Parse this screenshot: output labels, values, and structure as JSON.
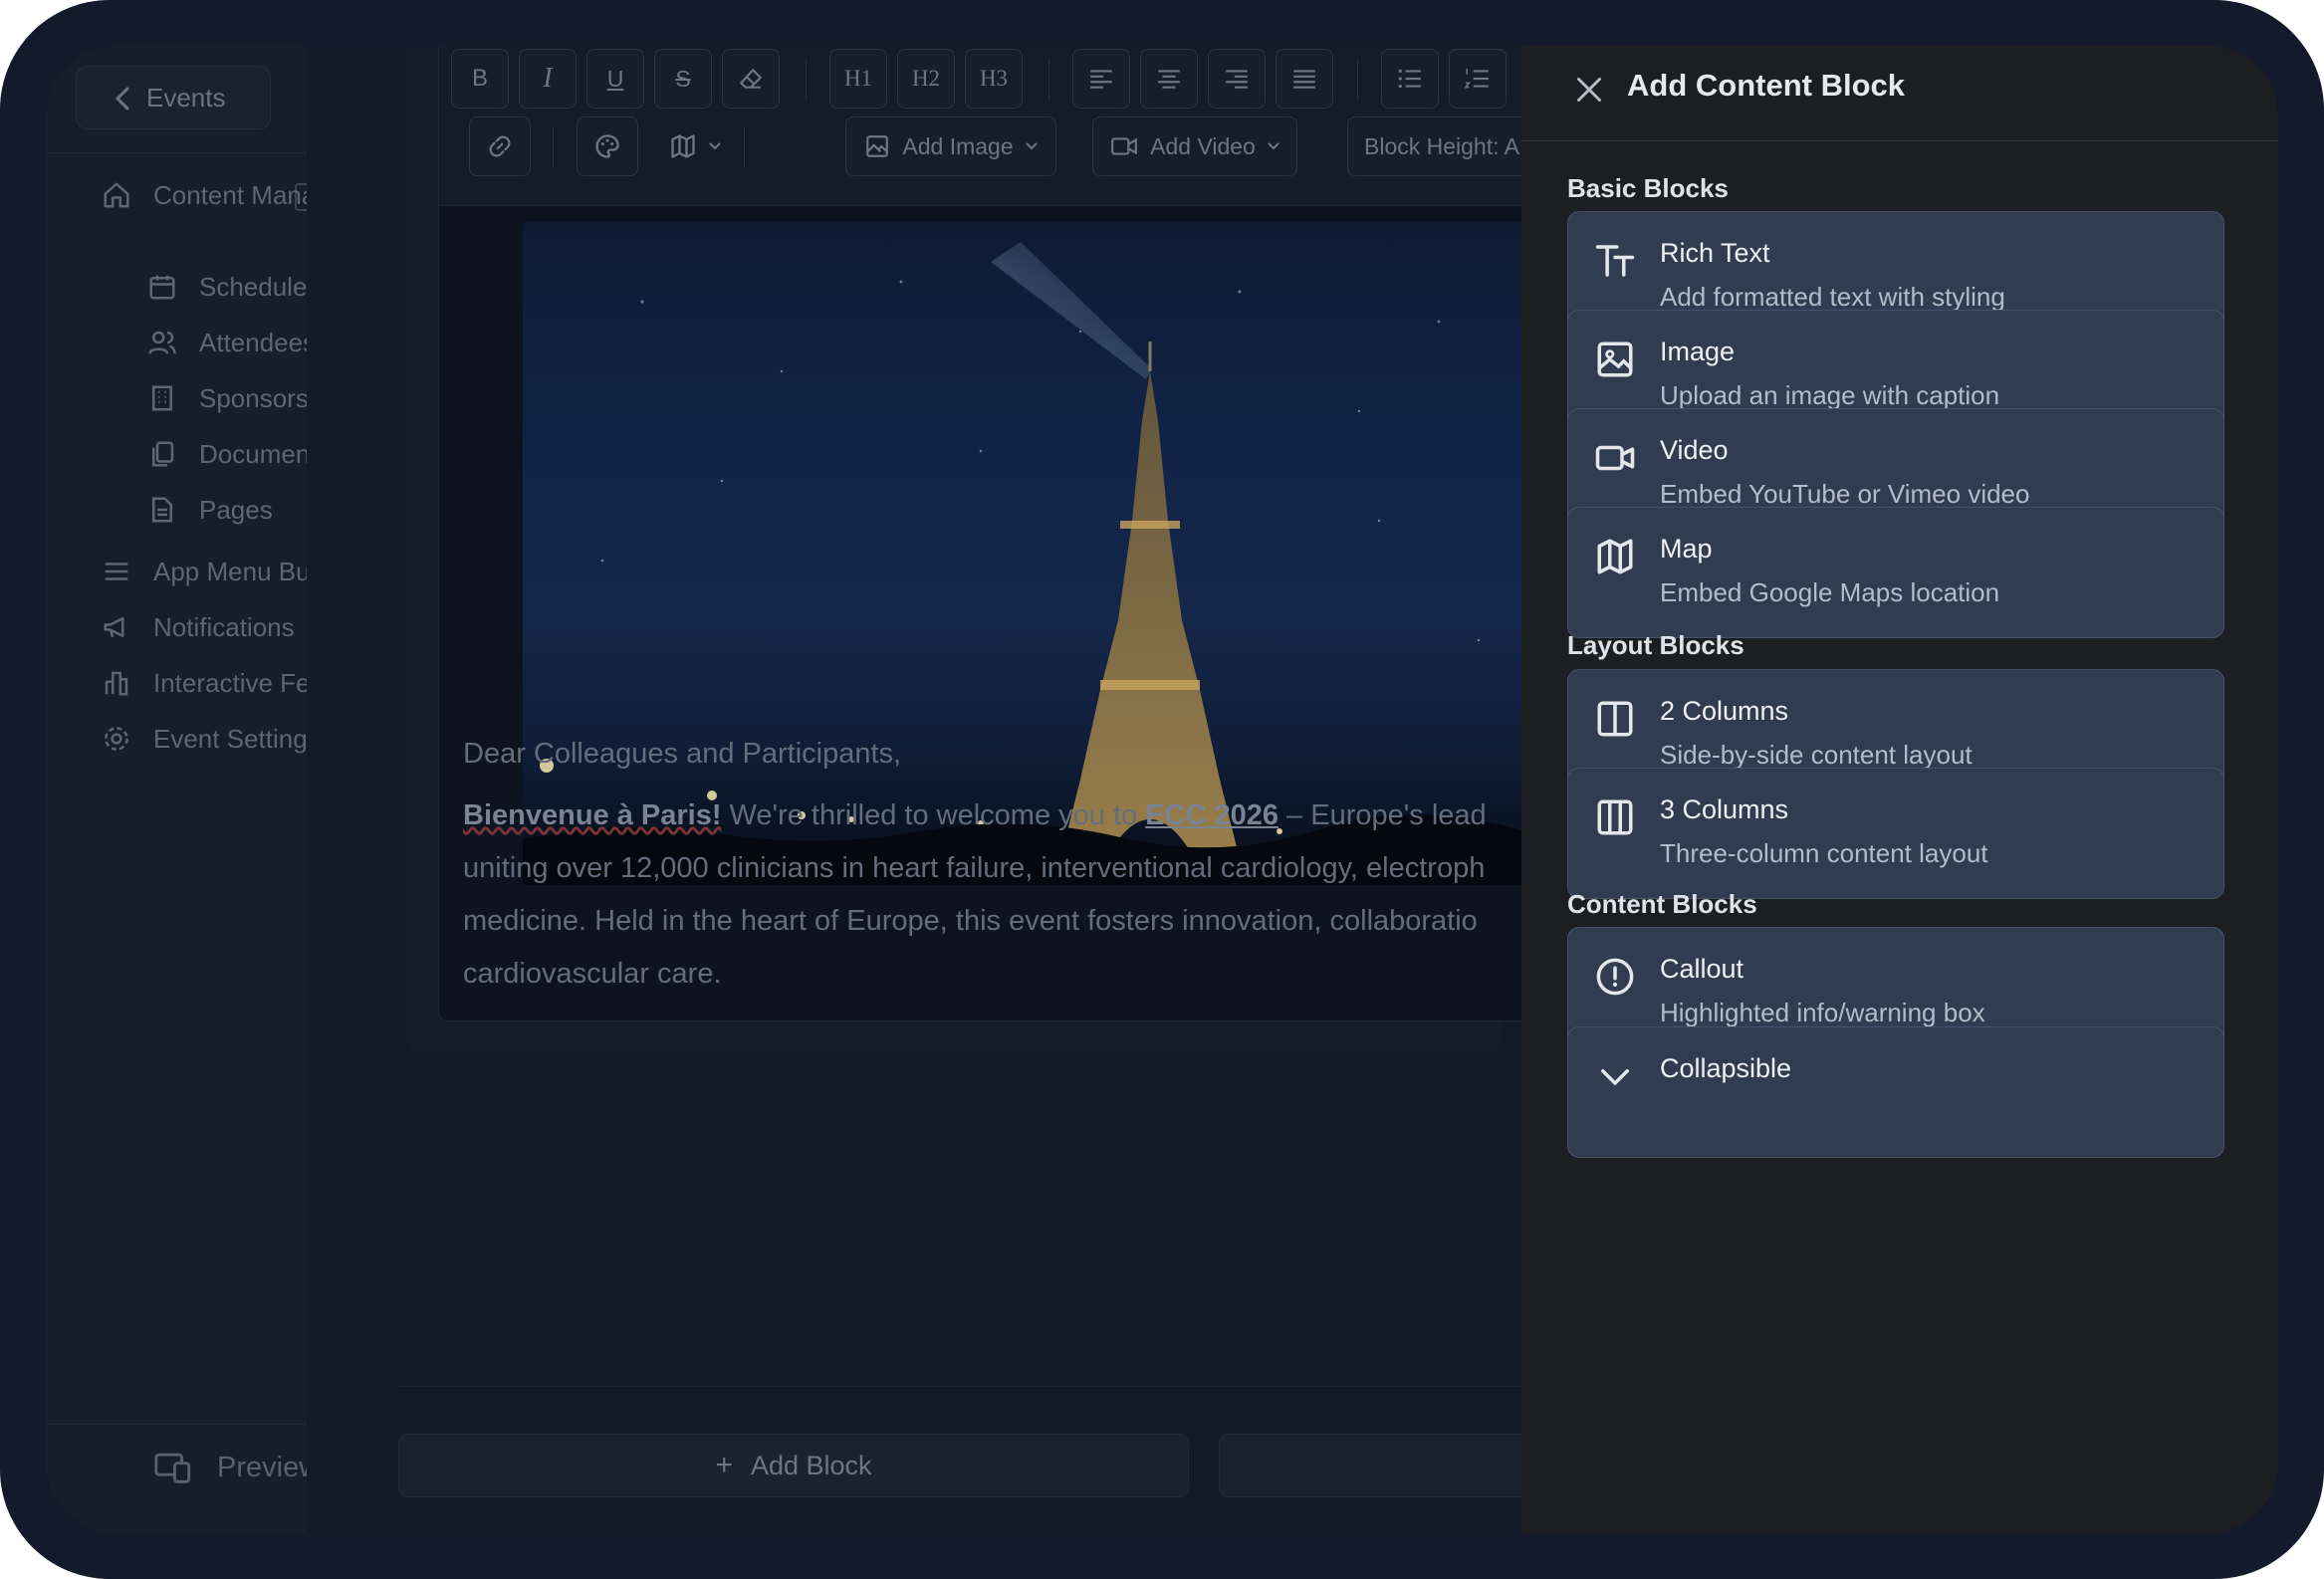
{
  "sidebar": {
    "back_label": "Events",
    "items": [
      {
        "label": "Content Management",
        "icon": "home-icon"
      },
      {
        "label": "Schedule",
        "icon": "calendar-icon"
      },
      {
        "label": "Attendees",
        "icon": "users-icon"
      },
      {
        "label": "Sponsors",
        "icon": "building-icon"
      },
      {
        "label": "Documents",
        "icon": "copy-icon"
      },
      {
        "label": "Pages",
        "icon": "file-icon"
      },
      {
        "label": "App Menu Builder",
        "icon": "menu-icon"
      },
      {
        "label": "Notifications",
        "icon": "megaphone-icon"
      },
      {
        "label": "Interactive Features",
        "icon": "bar-chart-icon"
      },
      {
        "label": "Event Settings",
        "icon": "gear-icon"
      }
    ],
    "preview_label": "Preview"
  },
  "toolbar": {
    "bold": "B",
    "italic": "I",
    "underline": "U",
    "strike": "S",
    "h1": "H1",
    "h2": "H2",
    "h3": "H3",
    "add_image": "Add Image",
    "add_video": "Add Video",
    "block_height": "Block Height: A"
  },
  "editor": {
    "greeting": "Dear Colleagues and Participants,",
    "p1_bold": "Bienvenue à Paris!",
    "p1_a": " We're thrilled to welcome you to ",
    "p1_link": "ECC 2026",
    "p1_b": " – Europe's lead",
    "line2": "uniting over 12,000 clinicians in heart failure, interventional cardiology, electroph",
    "line3": "medicine. Held in the heart of Europe, this event fosters innovation, collaboratio",
    "line4": "cardiovascular care."
  },
  "footer": {
    "add_block": "Add Block"
  },
  "drawer": {
    "title": "Add Content Block",
    "sections": [
      {
        "title": "Basic Blocks",
        "blocks": [
          {
            "name": "Rich Text",
            "desc": "Add formatted text with styling",
            "icon": "text-icon"
          },
          {
            "name": "Image",
            "desc": "Upload an image with caption",
            "icon": "image-icon"
          },
          {
            "name": "Video",
            "desc": "Embed YouTube or Vimeo video",
            "icon": "video-icon"
          },
          {
            "name": "Map",
            "desc": "Embed Google Maps location",
            "icon": "map-icon"
          }
        ]
      },
      {
        "title": "Layout Blocks",
        "blocks": [
          {
            "name": "2 Columns",
            "desc": "Side-by-side content layout",
            "icon": "columns-2-icon"
          },
          {
            "name": "3 Columns",
            "desc": "Three-column content layout",
            "icon": "columns-3-icon"
          }
        ]
      },
      {
        "title": "Content Blocks",
        "blocks": [
          {
            "name": "Callout",
            "desc": "Highlighted info/warning box",
            "icon": "alert-circle-icon"
          },
          {
            "name": "Collapsible",
            "desc": "",
            "icon": "chevron-down-icon"
          }
        ]
      }
    ]
  },
  "colors": {
    "drawer_bg": "#1d1e22",
    "card_bg": "#313c51",
    "card_border": "#46526a",
    "overlay_bg": "#101827"
  }
}
